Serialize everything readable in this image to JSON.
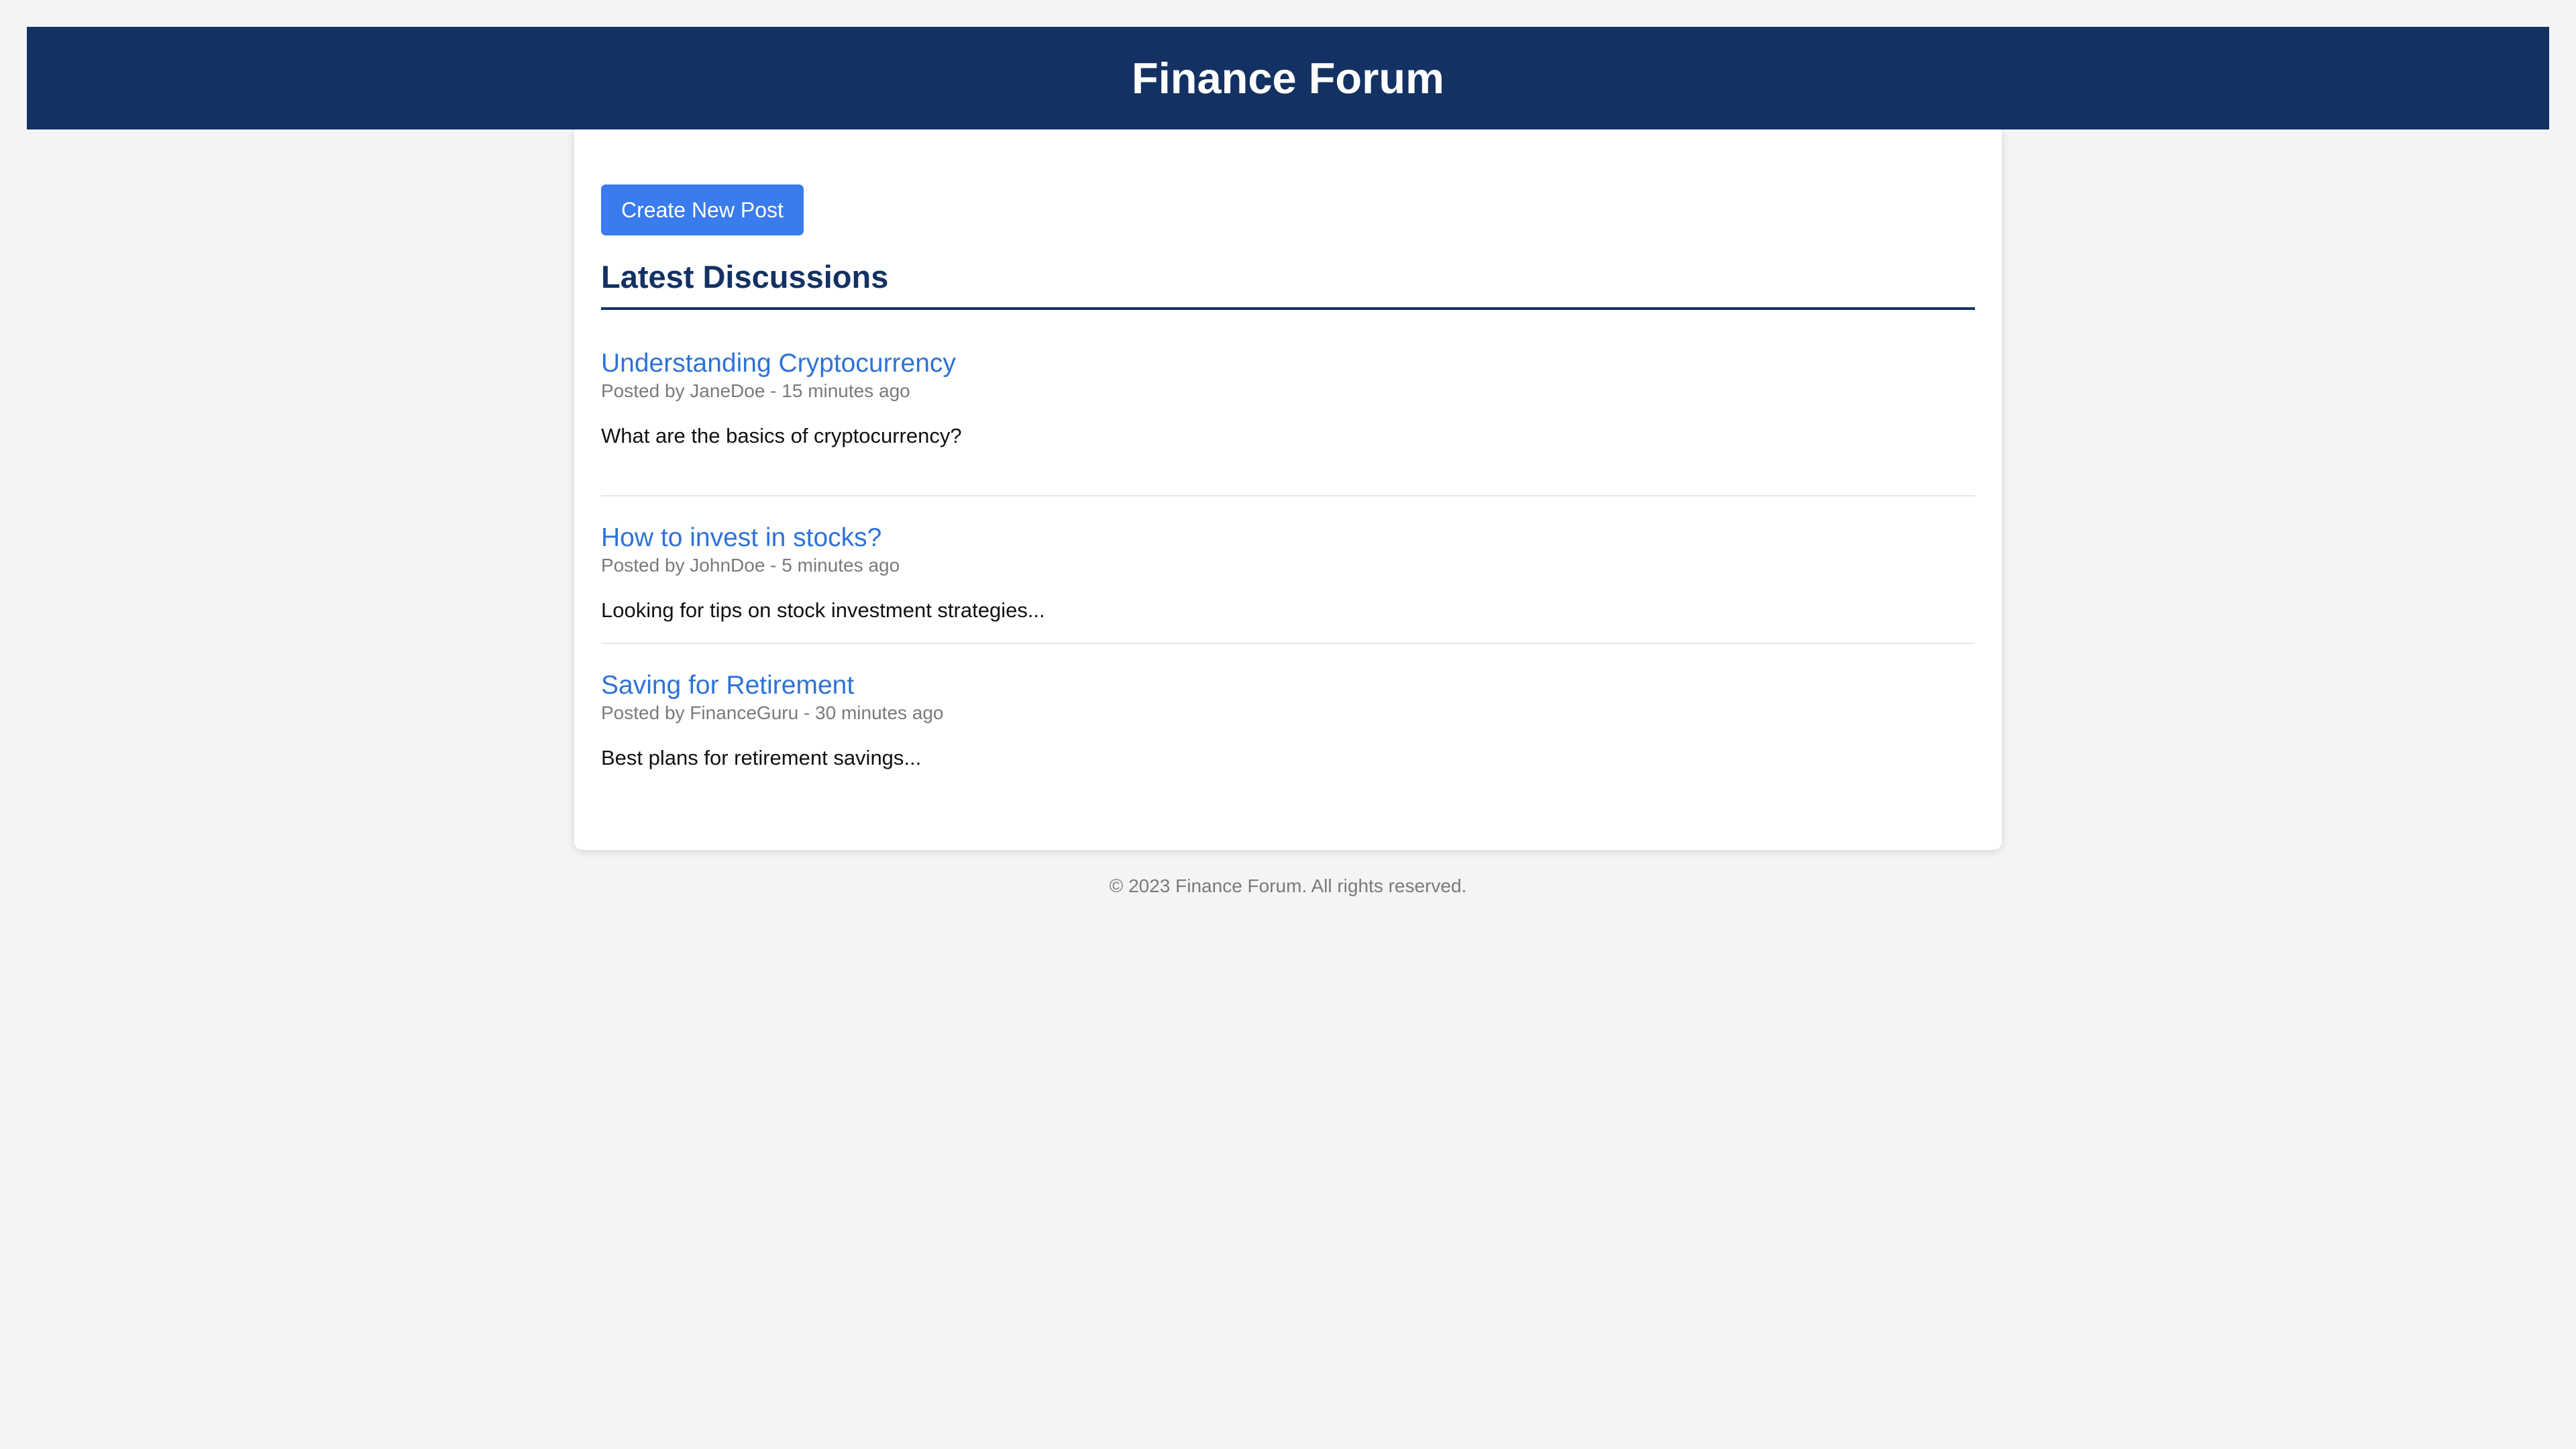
{
  "header": {
    "title": "Finance Forum"
  },
  "main": {
    "create_button_label": "Create New Post",
    "section_title": "Latest Discussions",
    "posts": [
      {
        "title": "Understanding Cryptocurrency",
        "meta": "Posted by JaneDoe - 15 minutes ago",
        "excerpt": "What are the basics of cryptocurrency?"
      },
      {
        "title": "How to invest in stocks?",
        "meta": "Posted by JohnDoe - 5 minutes ago",
        "excerpt": "Looking for tips on stock investment strategies..."
      },
      {
        "title": "Saving for Retirement",
        "meta": "Posted by FinanceGuru - 30 minutes ago",
        "excerpt": "Best plans for retirement savings..."
      }
    ]
  },
  "footer": {
    "copyright": "© 2023 Finance Forum. All rights reserved."
  },
  "colors": {
    "header_background": "#133263",
    "button_background": "#3a7bed",
    "link": "#2f72d8",
    "page_background": "#f4f4f4"
  }
}
